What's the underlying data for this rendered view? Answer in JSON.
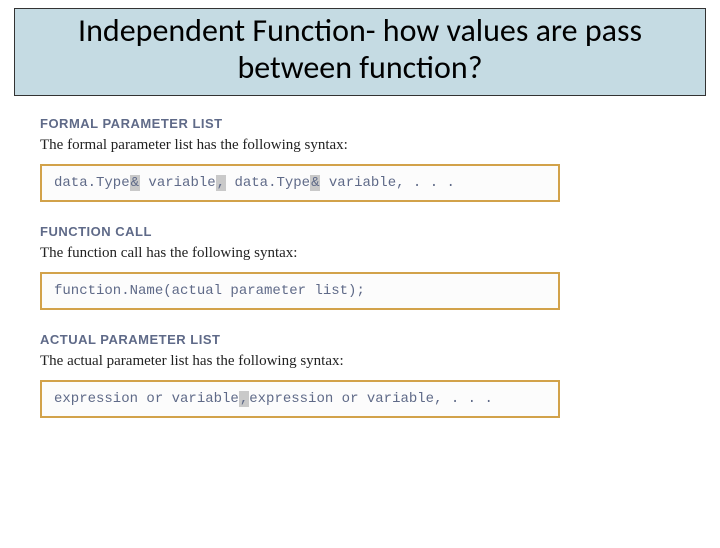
{
  "title": "Independent Function- how values are pass between function?",
  "sections": [
    {
      "heading": "FORMAL PARAMETER LIST",
      "desc": "The formal parameter list has the following syntax:",
      "code_html": "data.Type<span class='hl'>&amp;</span> variable<span class='hl'>,</span> data.Type<span class='hl'>&amp;</span> variable, . . ."
    },
    {
      "heading": "FUNCTION CALL",
      "desc": "The function call has the following syntax:",
      "code_html": "function.Name(actual parameter list);"
    },
    {
      "heading": "ACTUAL PARAMETER LIST",
      "desc": "The actual parameter list has the following syntax:",
      "code_html": "expression or variable<span class='hl'>,</span>expression or variable, . . ."
    }
  ]
}
